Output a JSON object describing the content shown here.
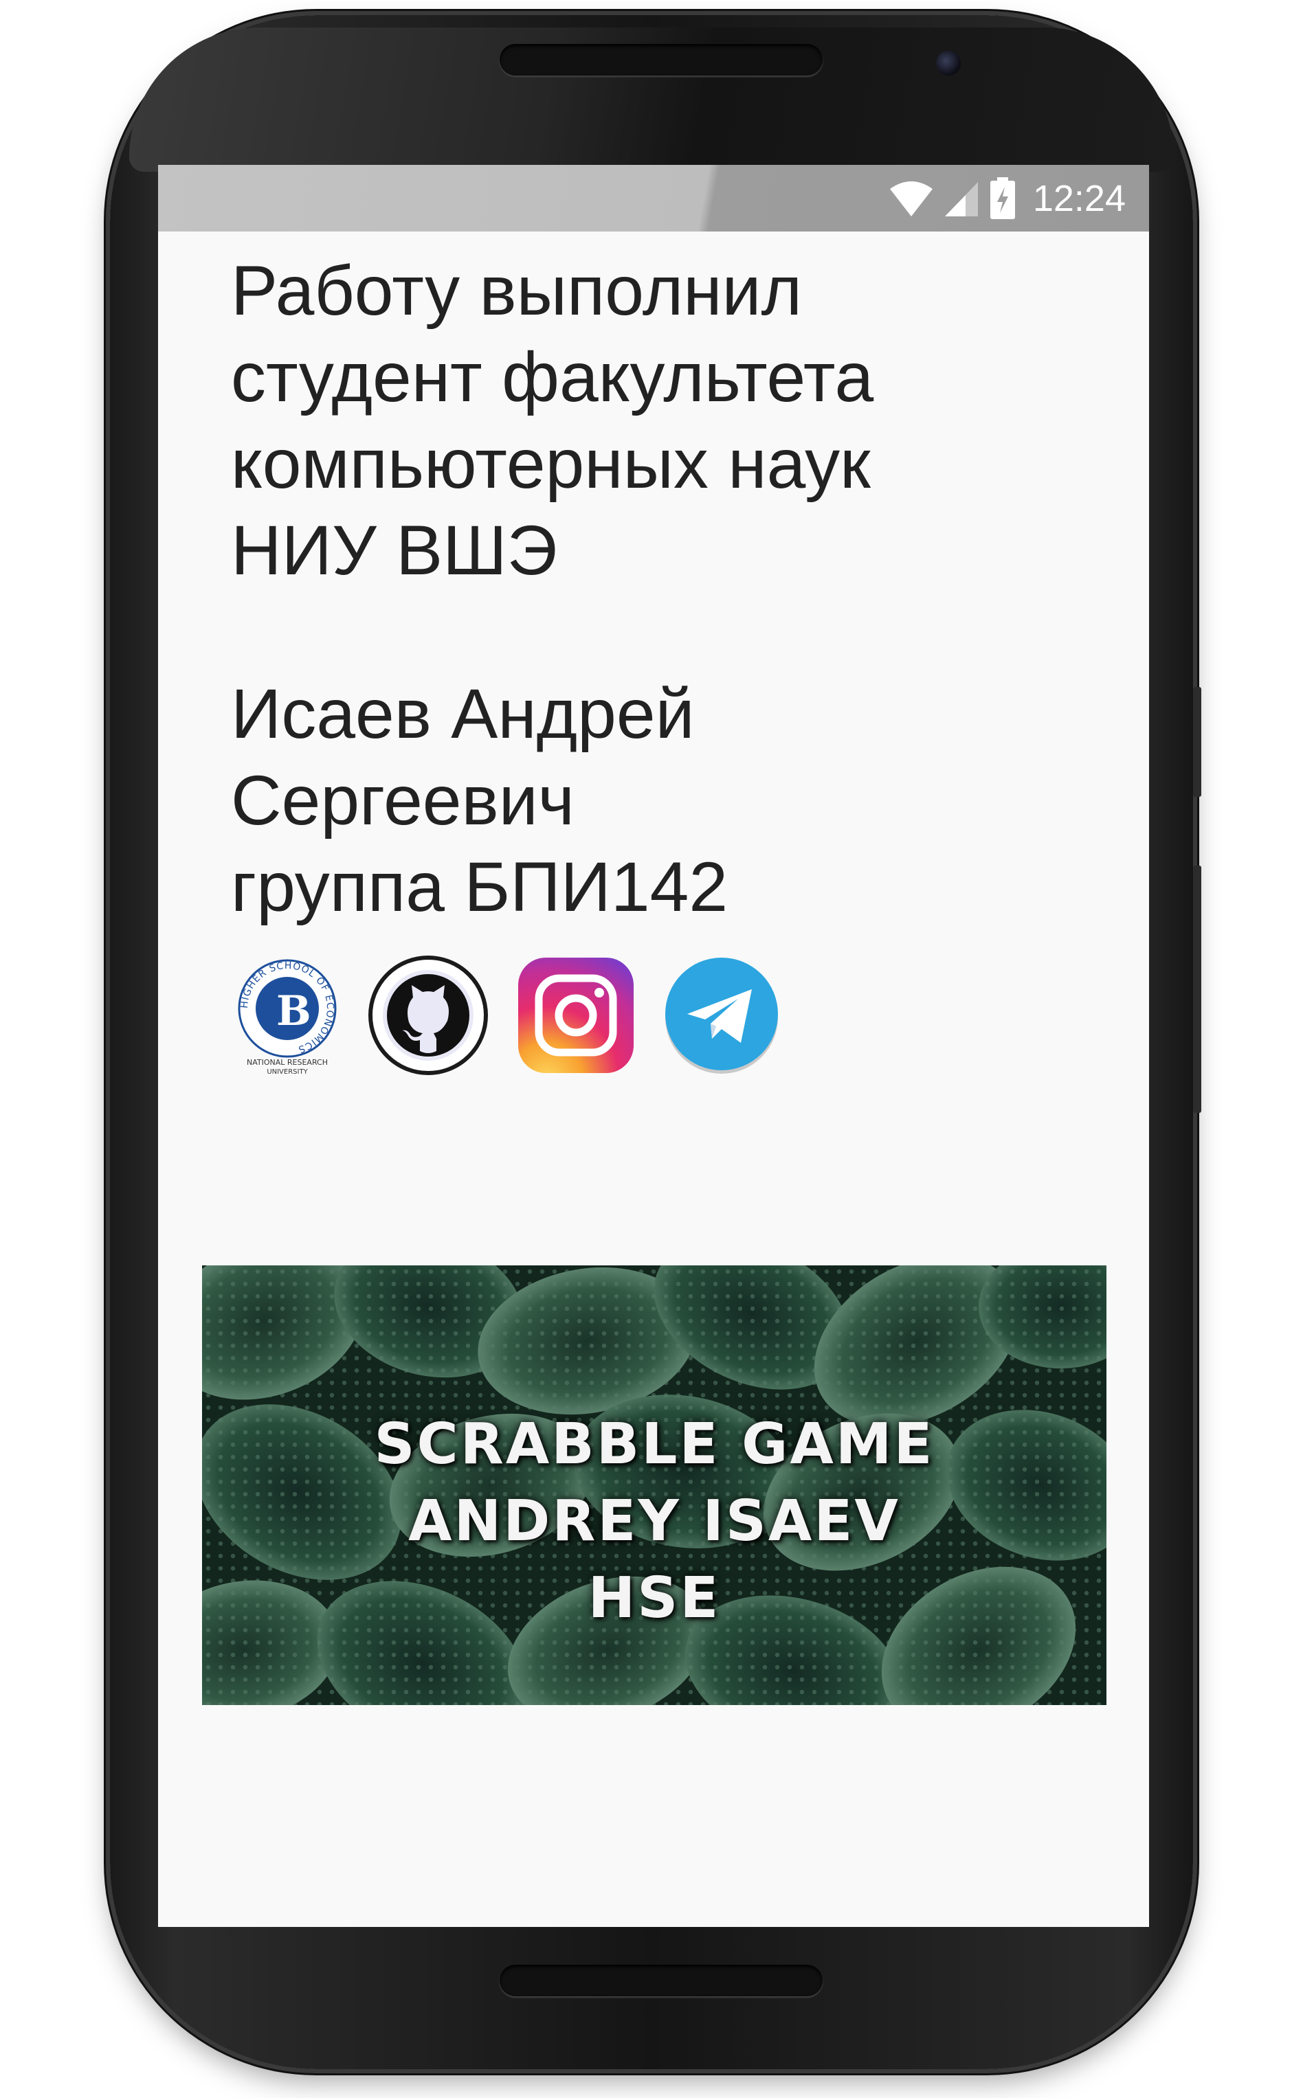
{
  "status_bar": {
    "time": "12:24",
    "icons": [
      "wifi-icon",
      "signal-icon",
      "battery-charging-icon"
    ]
  },
  "about": {
    "intro_lines": [
      "Работу выполнил",
      "студент факультета",
      "компьютерных наук",
      "НИУ ВШЭ"
    ],
    "author_lines": [
      "Исаев Андрей",
      "Сергеевич",
      "группа БПИ142"
    ]
  },
  "links": [
    {
      "name": "hse-logo",
      "icon": "hse-logo-icon"
    },
    {
      "name": "github",
      "icon": "github-icon"
    },
    {
      "name": "instagram",
      "icon": "instagram-icon"
    },
    {
      "name": "telegram",
      "icon": "telegram-icon"
    }
  ],
  "hse_logo_text": {
    "ring": "HIGHER SCHOOL OF ECONOMICS",
    "caption_line1": "NATIONAL RESEARCH",
    "caption_line2": "UNIVERSITY"
  },
  "banner": {
    "lines": [
      "SCRABBLE GAME",
      "ANDREY ISAEV",
      "HSE"
    ]
  },
  "colors": {
    "screen_bg": "#f9f9f9",
    "status_bar": "#bdbdbd",
    "text": "#222222",
    "telegram": "#2ca5e0",
    "hse_blue": "#1d4f9c"
  }
}
